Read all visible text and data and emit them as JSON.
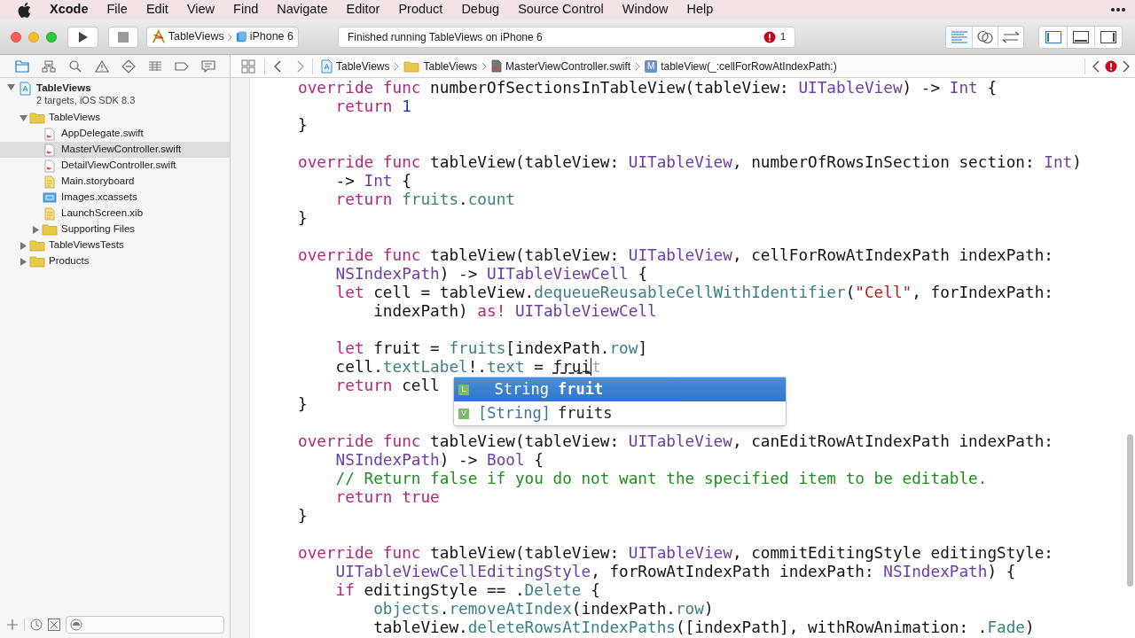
{
  "menu_bar": {
    "app": "Xcode",
    "items": [
      "File",
      "Edit",
      "View",
      "Find",
      "Navigate",
      "Editor",
      "Product",
      "Debug",
      "Source Control",
      "Window",
      "Help"
    ]
  },
  "toolbar": {
    "scheme": "TableViews",
    "device": "iPhone 6",
    "status": "Finished running TableViews on iPhone 6",
    "error_count": "1",
    "editor_modes": [
      {
        "kind": "standard",
        "selected": true
      },
      {
        "kind": "assistant",
        "selected": false
      },
      {
        "kind": "version",
        "selected": false
      }
    ],
    "panel_toggles": [
      {
        "kind": "navigator",
        "on": true
      },
      {
        "kind": "debug",
        "on": false
      },
      {
        "kind": "utilities",
        "on": false
      }
    ]
  },
  "navigator": {
    "tabs": [
      {
        "kind": "project",
        "selected": true
      },
      {
        "kind": "symbol",
        "selected": false
      },
      {
        "kind": "find",
        "selected": false
      },
      {
        "kind": "issue",
        "selected": false
      },
      {
        "kind": "test",
        "selected": false
      },
      {
        "kind": "debug",
        "selected": false
      },
      {
        "kind": "breakpoint",
        "selected": false
      },
      {
        "kind": "report",
        "selected": false
      }
    ],
    "tree": [
      {
        "name": "TableViews",
        "subtitle": "2 targets, iOS SDK 8.3",
        "kind": "project",
        "expanded": true,
        "selected": false,
        "children": [
          {
            "name": "TableViews",
            "kind": "folder",
            "expanded": true,
            "selected": false,
            "children": [
              {
                "name": "AppDelegate.swift",
                "kind": "swift",
                "selected": false
              },
              {
                "name": "MasterViewController.swift",
                "kind": "swift",
                "selected": true
              },
              {
                "name": "DetailViewController.swift",
                "kind": "swift",
                "selected": false
              },
              {
                "name": "Main.storyboard",
                "kind": "storyboard",
                "selected": false
              },
              {
                "name": "Images.xcassets",
                "kind": "assets",
                "selected": false
              },
              {
                "name": "LaunchScreen.xib",
                "kind": "storyboard",
                "selected": false
              },
              {
                "name": "Supporting Files",
                "kind": "folder",
                "expanded": false,
                "selected": false
              }
            ]
          },
          {
            "name": "TableViewsTests",
            "kind": "folder",
            "expanded": false,
            "selected": false
          },
          {
            "name": "Products",
            "kind": "folder",
            "expanded": false,
            "selected": false
          }
        ]
      }
    ]
  },
  "jump_bar": {
    "crumbs": [
      {
        "label": "TableViews",
        "kind": "project"
      },
      {
        "label": "TableViews",
        "kind": "folder"
      },
      {
        "label": "MasterViewController.swift",
        "kind": "swift"
      },
      {
        "label": "tableView(_:cellForRowAtIndexPath:)",
        "kind": "method",
        "badge": "M"
      }
    ]
  },
  "editor": {
    "blocks": [
      {
        "lines": [
          [
            {
              "kind": "keyword",
              "text": "override"
            },
            {
              "kind": "keyword",
              "text": " func"
            },
            {
              "kind": "plain",
              "text": " numberOfSectionsInTableView(tableView:"
            },
            {
              "kind": "type",
              "text": " UITableView"
            },
            {
              "kind": "plain",
              "text": ") ->"
            },
            {
              "kind": "type",
              "text": " Int"
            },
            {
              "kind": "plain",
              "text": " {"
            }
          ],
          [
            {
              "kind": "keyword",
              "text": "    return"
            },
            {
              "kind": "number",
              "text": " 1"
            }
          ],
          [
            {
              "kind": "plain",
              "text": "}"
            }
          ]
        ]
      },
      {
        "lines": [
          [
            {
              "kind": "keyword",
              "text": "override"
            },
            {
              "kind": "keyword",
              "text": " func"
            },
            {
              "kind": "plain",
              "text": " tableView(tableView:"
            },
            {
              "kind": "type",
              "text": " UITableView"
            },
            {
              "kind": "plain",
              "text": ", numberOfRowsInSection section:"
            },
            {
              "kind": "type",
              "text": " Int"
            },
            {
              "kind": "plain",
              "text": ")"
            }
          ],
          [
            {
              "kind": "plain",
              "text": "    ->"
            },
            {
              "kind": "type",
              "text": " Int"
            },
            {
              "kind": "plain",
              "text": " {"
            }
          ],
          [
            {
              "kind": "keyword",
              "text": "    return"
            },
            {
              "kind": "ident",
              "text": " fruits"
            },
            {
              "kind": "plain",
              "text": "."
            },
            {
              "kind": "ident",
              "text": "count"
            }
          ],
          [
            {
              "kind": "plain",
              "text": "}"
            }
          ]
        ]
      },
      {
        "lines": [
          [
            {
              "kind": "keyword",
              "text": "override"
            },
            {
              "kind": "keyword",
              "text": " func"
            },
            {
              "kind": "plain",
              "text": " tableView(tableView:"
            },
            {
              "kind": "type",
              "text": " UITableView"
            },
            {
              "kind": "plain",
              "text": ", cellForRowAtIndexPath indexPath:"
            }
          ],
          [
            {
              "kind": "type",
              "text": "    NSIndexPath"
            },
            {
              "kind": "plain",
              "text": ") ->"
            },
            {
              "kind": "type",
              "text": " UITableViewCell"
            },
            {
              "kind": "plain",
              "text": " {"
            }
          ],
          [
            {
              "kind": "keyword",
              "text": "    let"
            },
            {
              "kind": "plain",
              "text": " cell = tableView."
            },
            {
              "kind": "ident",
              "text": "dequeueReusableCellWithIdentifier"
            },
            {
              "kind": "plain",
              "text": "("
            },
            {
              "kind": "string",
              "text": "\"Cell\""
            },
            {
              "kind": "plain",
              "text": ", forIndexPath:"
            }
          ],
          [
            {
              "kind": "plain",
              "text": "        indexPath)"
            },
            {
              "kind": "keyword",
              "text": " as!"
            },
            {
              "kind": "type",
              "text": " UITableViewCell"
            }
          ]
        ]
      },
      {
        "lines": [
          [
            {
              "kind": "keyword",
              "text": "    let"
            },
            {
              "kind": "plain",
              "text": " fruit ="
            },
            {
              "kind": "ident",
              "text": " fruits"
            },
            {
              "kind": "plain",
              "text": "[indexPath."
            },
            {
              "kind": "ident",
              "text": "row"
            },
            {
              "kind": "plain",
              "text": "]"
            }
          ],
          [
            {
              "kind": "plain",
              "text": "    cell."
            },
            {
              "kind": "ident",
              "text": "textLabel"
            },
            {
              "kind": "plain",
              "text": "!."
            },
            {
              "kind": "ident",
              "text": "text"
            },
            {
              "kind": "plain",
              "text": " = "
            },
            {
              "kind": "typed",
              "text": "frui"
            },
            {
              "kind": "ghost",
              "text": "t"
            }
          ],
          [
            {
              "kind": "keyword",
              "text": "    return"
            },
            {
              "kind": "plain",
              "text": " cell"
            }
          ],
          [
            {
              "kind": "plain",
              "text": "}"
            }
          ]
        ]
      },
      {
        "lines": [
          [
            {
              "kind": "keyword",
              "text": "override"
            },
            {
              "kind": "keyword",
              "text": " func"
            },
            {
              "kind": "plain",
              "text": " tableView(tableView:"
            },
            {
              "kind": "type",
              "text": " UITableView"
            },
            {
              "kind": "plain",
              "text": ", canEditRowAtIndexPath indexPath:"
            }
          ],
          [
            {
              "kind": "type",
              "text": "    NSIndexPath"
            },
            {
              "kind": "plain",
              "text": ") ->"
            },
            {
              "kind": "type",
              "text": " Bool"
            },
            {
              "kind": "plain",
              "text": " {"
            }
          ],
          [
            {
              "kind": "comment",
              "text": "    // Return false if you do not want the specified item to be editable."
            }
          ],
          [
            {
              "kind": "keyword",
              "text": "    return"
            },
            {
              "kind": "keyword",
              "text": " true"
            }
          ],
          [
            {
              "kind": "plain",
              "text": "}"
            }
          ]
        ]
      },
      {
        "lines": [
          [
            {
              "kind": "keyword",
              "text": "override"
            },
            {
              "kind": "keyword",
              "text": " func"
            },
            {
              "kind": "plain",
              "text": " tableView(tableView:"
            },
            {
              "kind": "type",
              "text": " UITableView"
            },
            {
              "kind": "plain",
              "text": ", commitEditingStyle editingStyle:"
            }
          ],
          [
            {
              "kind": "type",
              "text": "    UITableViewCellEditingStyle"
            },
            {
              "kind": "plain",
              "text": ", forRowAtIndexPath indexPath:"
            },
            {
              "kind": "type",
              "text": " NSIndexPath"
            },
            {
              "kind": "plain",
              "text": ") {"
            }
          ],
          [
            {
              "kind": "keyword",
              "text": "    if"
            },
            {
              "kind": "plain",
              "text": " editingStyle == ."
            },
            {
              "kind": "ident",
              "text": "Delete"
            },
            {
              "kind": "plain",
              "text": " {"
            }
          ],
          [
            {
              "kind": "ident",
              "text": "        objects"
            },
            {
              "kind": "plain",
              "text": "."
            },
            {
              "kind": "ident",
              "text": "removeAtIndex"
            },
            {
              "kind": "plain",
              "text": "(indexPath."
            },
            {
              "kind": "ident",
              "text": "row"
            },
            {
              "kind": "plain",
              "text": ")"
            }
          ],
          [
            {
              "kind": "plain",
              "text": "        tableView."
            },
            {
              "kind": "ident",
              "text": "deleteRowsAtIndexPaths"
            },
            {
              "kind": "plain",
              "text": "([indexPath], withRowAnimation: ."
            },
            {
              "kind": "ident",
              "text": "Fade"
            },
            {
              "kind": "plain",
              "text": ")"
            }
          ]
        ]
      }
    ],
    "completions": [
      {
        "badge": "L",
        "type": "String",
        "name": "fruit",
        "selected": true
      },
      {
        "badge": "V",
        "type": "[String]",
        "name": "fruits",
        "selected": false
      }
    ]
  }
}
